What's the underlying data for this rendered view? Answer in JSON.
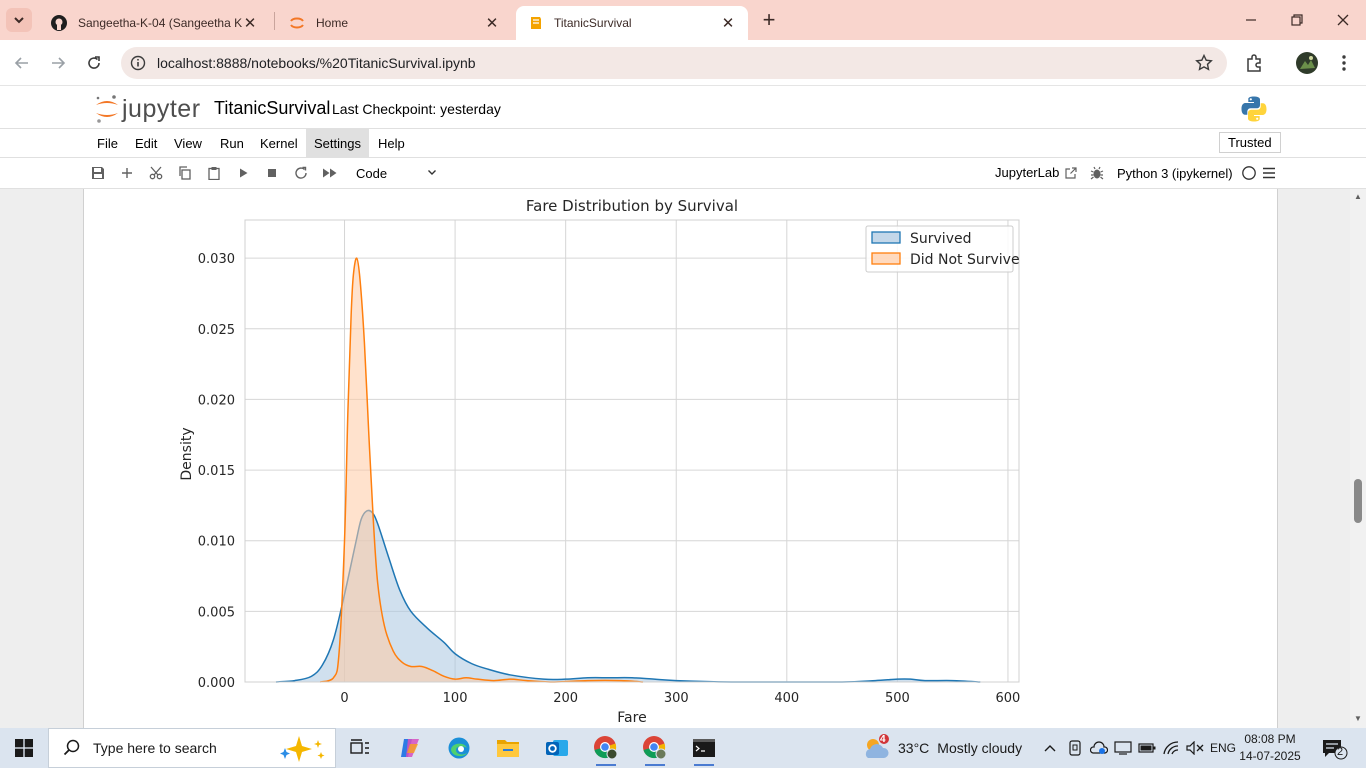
{
  "browser": {
    "tabs": [
      {
        "title": "Sangeetha-K-04 (Sangeetha K)",
        "icon": "github-icon"
      },
      {
        "title": "Home",
        "icon": "jupyter-icon"
      },
      {
        "title": "TitanicSurvival",
        "icon": "notebook-icon",
        "active": true
      }
    ],
    "url": "localhost:8888/notebooks/%20TitanicSurvival.ipynb"
  },
  "jupyter": {
    "logo_text": "jupyter",
    "notebook_title": "TitanicSurvival",
    "checkpoint": "Last Checkpoint: yesterday",
    "menu": [
      "File",
      "Edit",
      "View",
      "Run",
      "Kernel",
      "Settings",
      "Help"
    ],
    "highlighted_menu": "Settings",
    "trusted": "Trusted",
    "cell_type": "Code",
    "jupyterlab_link": "JupyterLab",
    "kernel": "Python 3 (ipykernel)"
  },
  "chart_data": {
    "type": "area",
    "title": "Fare Distribution by Survival",
    "xlabel": "Fare",
    "ylabel": "Density",
    "xlim": [
      -90,
      610
    ],
    "ylim": [
      0,
      0.0327
    ],
    "xticks": [
      0,
      100,
      200,
      300,
      400,
      500,
      600
    ],
    "yticks": [
      0.0,
      0.005,
      0.01,
      0.015,
      0.02,
      0.025,
      0.03
    ],
    "ytick_labels": [
      "0.000",
      "0.005",
      "0.010",
      "0.015",
      "0.020",
      "0.025",
      "0.030"
    ],
    "grid": true,
    "legend": "top-right",
    "series": [
      {
        "name": "Survived",
        "color": "#1f77b4",
        "fill": "#a9c6e0",
        "points": [
          [
            -62,
            0
          ],
          [
            -45,
            0.0001
          ],
          [
            -30,
            0.0004
          ],
          [
            -20,
            0.0012
          ],
          [
            -10,
            0.003
          ],
          [
            0,
            0.0062
          ],
          [
            10,
            0.0098
          ],
          [
            15,
            0.0115
          ],
          [
            20,
            0.0121
          ],
          [
            25,
            0.012
          ],
          [
            30,
            0.0112
          ],
          [
            40,
            0.0088
          ],
          [
            50,
            0.0065
          ],
          [
            60,
            0.005
          ],
          [
            75,
            0.0038
          ],
          [
            90,
            0.0028
          ],
          [
            100,
            0.002
          ],
          [
            115,
            0.0013
          ],
          [
            130,
            0.0009
          ],
          [
            150,
            0.0005
          ],
          [
            180,
            0.0002
          ],
          [
            200,
            0.0002
          ],
          [
            220,
            0.0003
          ],
          [
            240,
            0.0003
          ],
          [
            260,
            0.0003
          ],
          [
            280,
            0.0002
          ],
          [
            300,
            0.0001
          ],
          [
            350,
            0
          ],
          [
            400,
            0
          ],
          [
            450,
            0
          ],
          [
            480,
            0.0001
          ],
          [
            500,
            0.0002
          ],
          [
            512,
            0.0002
          ],
          [
            525,
            0.0001
          ],
          [
            550,
            0.0001
          ],
          [
            575,
            0
          ]
        ]
      },
      {
        "name": "Did Not Survive",
        "color": "#ff7f0e",
        "fill": "#ffcba4",
        "points": [
          [
            -22,
            0
          ],
          [
            -10,
            0.0003
          ],
          [
            -5,
            0.002
          ],
          [
            0,
            0.01
          ],
          [
            3,
            0.019
          ],
          [
            6,
            0.026
          ],
          [
            8,
            0.0288
          ],
          [
            11,
            0.03
          ],
          [
            14,
            0.0285
          ],
          [
            18,
            0.024
          ],
          [
            22,
            0.0175
          ],
          [
            26,
            0.0115
          ],
          [
            30,
            0.007
          ],
          [
            36,
            0.004
          ],
          [
            44,
            0.0022
          ],
          [
            52,
            0.0014
          ],
          [
            60,
            0.0011
          ],
          [
            70,
            0.0011
          ],
          [
            80,
            0.0008
          ],
          [
            90,
            0.0004
          ],
          [
            100,
            0.0002
          ],
          [
            110,
            0.0003
          ],
          [
            120,
            0.0002
          ],
          [
            135,
            0.0001
          ],
          [
            150,
            0.0002
          ],
          [
            165,
            0.0001
          ],
          [
            190,
            0
          ],
          [
            220,
            0.0001
          ],
          [
            250,
            0.0001
          ],
          [
            270,
            0
          ]
        ]
      }
    ]
  },
  "taskbar": {
    "search_placeholder": "Type here to search",
    "weather_temp": "33°C",
    "weather_desc": "Mostly cloudy",
    "weather_badge": "4",
    "lang": "ENG",
    "time": "08:08 PM",
    "date": "14-07-2025",
    "notification_count": "2"
  }
}
